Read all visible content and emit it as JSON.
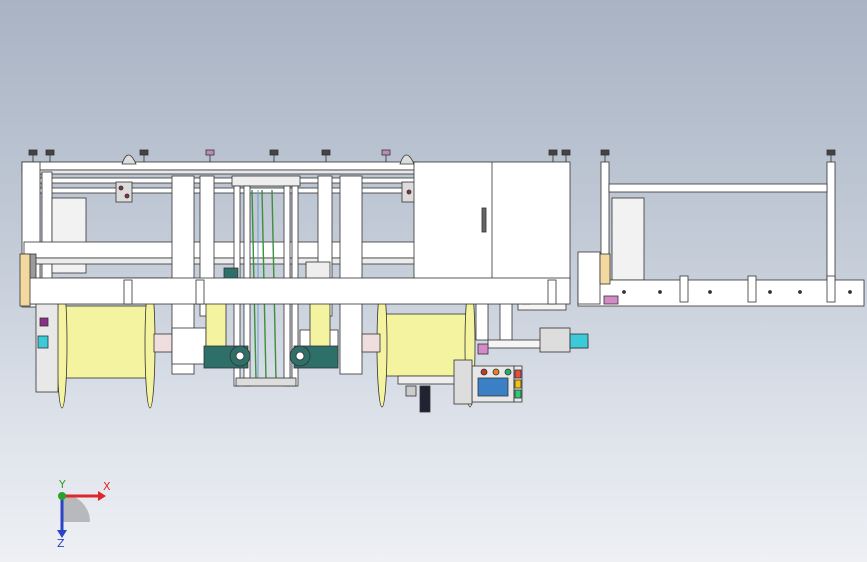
{
  "viewport": {
    "background_top": "#a9b3c3",
    "background_bottom": "#eef0f4"
  },
  "triad": {
    "x_label": "X",
    "y_label": "Y",
    "z_label": "Z",
    "x_color": "#e0262b",
    "y_color": "#2ca02c",
    "z_color": "#2c43c8"
  },
  "model": {
    "frame_color": "#ffffff",
    "spool_color": "#f3f3a0",
    "cabinet_color": "#ffffff",
    "motor_color": "#2f6f6a",
    "edge_color": "#333333"
  }
}
